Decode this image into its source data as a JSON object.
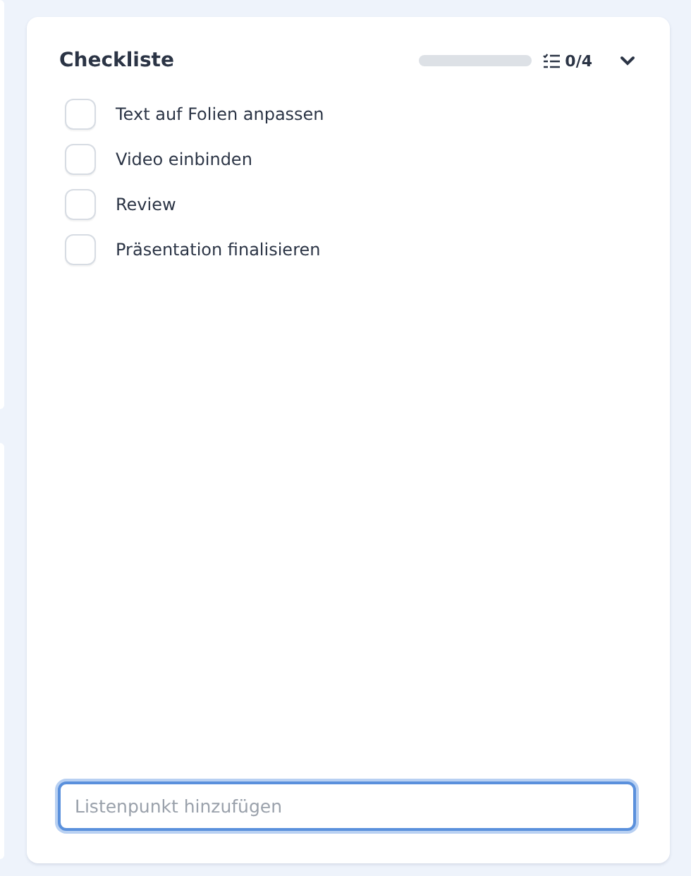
{
  "checklist": {
    "title": "Checkliste",
    "progress": {
      "level": 0,
      "count": "0/4"
    },
    "expanded": true,
    "items": [
      {
        "label": "Text auf Folien anpassen",
        "checked": false
      },
      {
        "label": "Video einbinden",
        "checked": false
      },
      {
        "label": "Review",
        "checked": false
      },
      {
        "label": "Präsentation finalisieren",
        "checked": false
      }
    ],
    "new_item": {
      "placeholder": "Listenpunkt hinzufügen"
    }
  }
}
